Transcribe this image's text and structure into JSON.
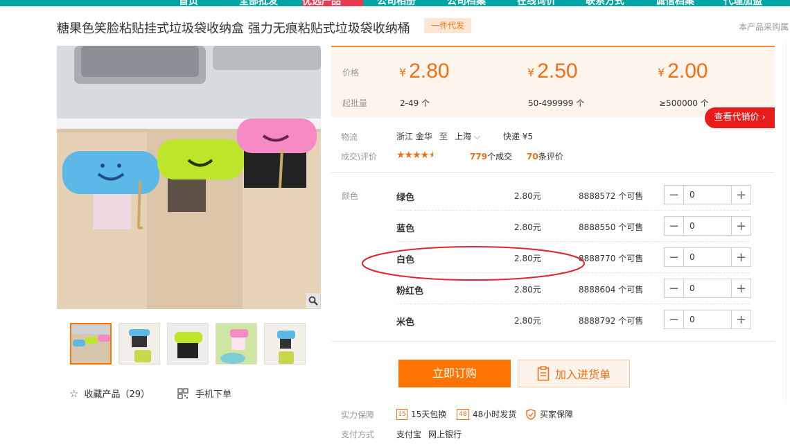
{
  "nav": {
    "items": [
      "首页",
      "全部批发",
      "优选产品",
      "公司相册",
      "公司档案",
      "在线询价",
      "联系方式",
      "诚信档案",
      "代理加盟"
    ]
  },
  "product": {
    "title": "糖果色笑脸粘贴挂式垃圾袋收纳盒 强力无痕粘贴式垃圾袋收纳桶",
    "badge": "一件代发",
    "report_link": "本产品采购属"
  },
  "pricing": {
    "price_label": "价格",
    "qty_label": "起批量",
    "currency": "¥",
    "tiers": [
      {
        "price": "2.80",
        "qty": "2-49 个"
      },
      {
        "price": "2.50",
        "qty": "50-499999 个"
      },
      {
        "price": "2.00",
        "qty": "≥500000 个"
      }
    ],
    "agent_button": "查看代销价"
  },
  "logistics": {
    "label": "物流",
    "from": "浙江 金华",
    "to_word": "至",
    "to": "上海",
    "express": "快递 ¥5"
  },
  "rating": {
    "label": "成交\\评价",
    "stars": 4.5,
    "deals_count": "779",
    "deals_suffix": "个成交",
    "reviews_count": "70",
    "reviews_suffix": "条评价"
  },
  "colors": {
    "label": "颜色",
    "rows": [
      {
        "name": "绿色",
        "price": "2.80元",
        "stock": "8888572 个可售",
        "qty": "0"
      },
      {
        "name": "蓝色",
        "price": "2.80元",
        "stock": "8888550 个可售",
        "qty": "0"
      },
      {
        "name": "白色",
        "price": "2.80元",
        "stock": "8888770 个可售",
        "qty": "0"
      },
      {
        "name": "粉红色",
        "price": "2.80元",
        "stock": "8888604 个可售",
        "qty": "0"
      },
      {
        "name": "米色",
        "price": "2.80元",
        "stock": "8888792 个可售",
        "qty": "0"
      }
    ]
  },
  "actions": {
    "buy": "立即订购",
    "add_to_list": "加入进货单"
  },
  "gallery": {
    "favorite": "收藏产品（29）",
    "mobile_order": "手机下单"
  },
  "guarantee": {
    "label": "实力保障",
    "items": [
      "15天包换",
      "48小时发货",
      "买家保障"
    ],
    "icon_texts": [
      "15",
      "48"
    ]
  },
  "payment": {
    "label": "支付方式",
    "methods": [
      "支付宝",
      "网上银行"
    ]
  },
  "theme": {
    "accent": "#f26d14",
    "buy_button": "#ff7300",
    "agent_red": "#e91c1c",
    "annotation_red": "#e0242b"
  }
}
